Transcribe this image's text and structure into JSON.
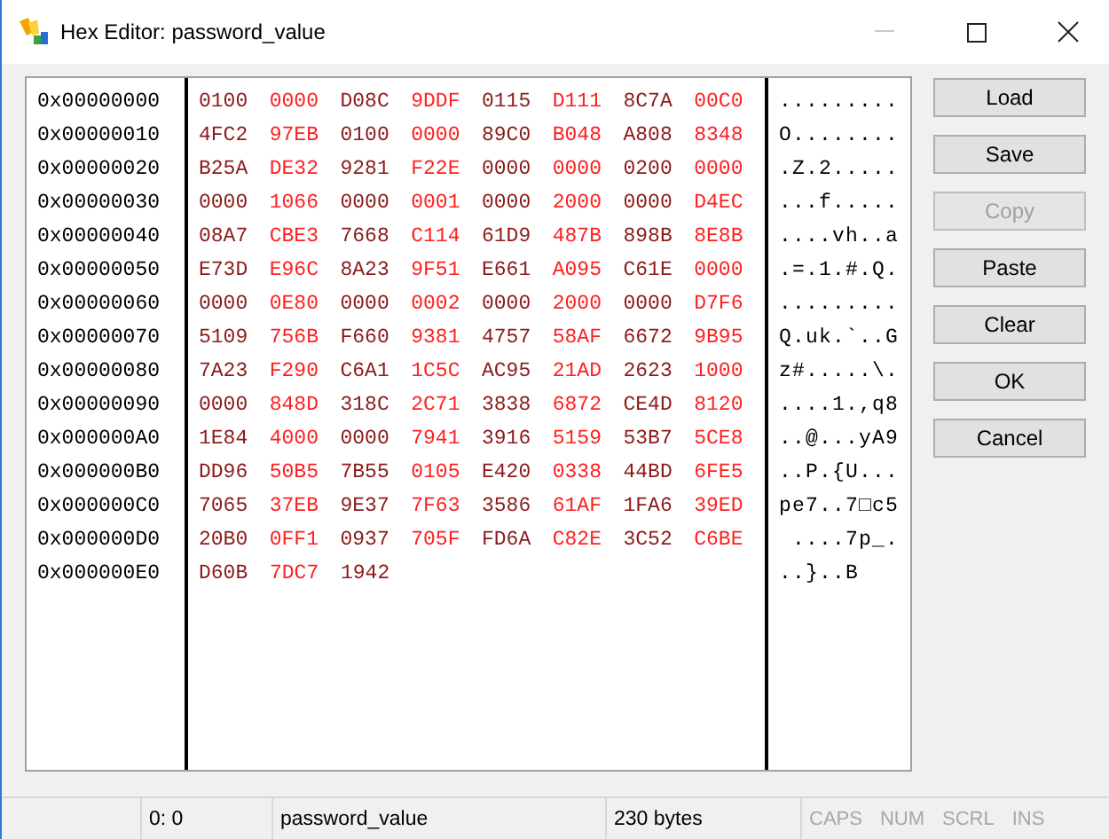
{
  "window": {
    "title": "Hex Editor: password_value",
    "controls": [
      {
        "kind": "minimize",
        "disabled": true
      },
      {
        "kind": "maximize",
        "disabled": false
      },
      {
        "kind": "close",
        "disabled": false
      }
    ]
  },
  "rows": [
    {
      "address": "0x00000000",
      "words": [
        "0100",
        "0000",
        "D08C",
        "9DDF",
        "0115",
        "D111",
        "8C7A",
        "00C0"
      ],
      "ascii": "........."
    },
    {
      "address": "0x00000010",
      "words": [
        "4FC2",
        "97EB",
        "0100",
        "0000",
        "89C0",
        "B048",
        "A808",
        "8348"
      ],
      "ascii": "O........"
    },
    {
      "address": "0x00000020",
      "words": [
        "B25A",
        "DE32",
        "9281",
        "F22E",
        "0000",
        "0000",
        "0200",
        "0000"
      ],
      "ascii": ".Z.2....."
    },
    {
      "address": "0x00000030",
      "words": [
        "0000",
        "1066",
        "0000",
        "0001",
        "0000",
        "2000",
        "0000",
        "D4EC"
      ],
      "ascii": "...f....."
    },
    {
      "address": "0x00000040",
      "words": [
        "08A7",
        "CBE3",
        "7668",
        "C114",
        "61D9",
        "487B",
        "898B",
        "8E8B"
      ],
      "ascii": "....vh..a"
    },
    {
      "address": "0x00000050",
      "words": [
        "E73D",
        "E96C",
        "8A23",
        "9F51",
        "E661",
        "A095",
        "C61E",
        "0000"
      ],
      "ascii": ".=.1.#.Q."
    },
    {
      "address": "0x00000060",
      "words": [
        "0000",
        "0E80",
        "0000",
        "0002",
        "0000",
        "2000",
        "0000",
        "D7F6"
      ],
      "ascii": "........."
    },
    {
      "address": "0x00000070",
      "words": [
        "5109",
        "756B",
        "F660",
        "9381",
        "4757",
        "58AF",
        "6672",
        "9B95"
      ],
      "ascii": "Q.uk.`..G"
    },
    {
      "address": "0x00000080",
      "words": [
        "7A23",
        "F290",
        "C6A1",
        "1C5C",
        "AC95",
        "21AD",
        "2623",
        "1000"
      ],
      "ascii": "z#.....\\."
    },
    {
      "address": "0x00000090",
      "words": [
        "0000",
        "848D",
        "318C",
        "2C71",
        "3838",
        "6872",
        "CE4D",
        "8120"
      ],
      "ascii": "....1.,q8"
    },
    {
      "address": "0x000000A0",
      "words": [
        "1E84",
        "4000",
        "0000",
        "7941",
        "3916",
        "5159",
        "53B7",
        "5CE8"
      ],
      "ascii": "..@...yA9"
    },
    {
      "address": "0x000000B0",
      "words": [
        "DD96",
        "50B5",
        "7B55",
        "0105",
        "E420",
        "0338",
        "44BD",
        "6FE5"
      ],
      "ascii": "..P.{U..."
    },
    {
      "address": "0x000000C0",
      "words": [
        "7065",
        "37EB",
        "9E37",
        "7F63",
        "3586",
        "61AF",
        "1FA6",
        "39ED"
      ],
      "ascii": "pe7..7□c5"
    },
    {
      "address": "0x000000D0",
      "words": [
        "20B0",
        "0FF1",
        "0937",
        "705F",
        "FD6A",
        "C82E",
        "3C52",
        "C6BE"
      ],
      "ascii": " ....7p_."
    },
    {
      "address": "0x000000E0",
      "words": [
        "D60B",
        "7DC7",
        "1942"
      ],
      "ascii": "..}..B"
    }
  ],
  "buttons": [
    {
      "label": "Load",
      "disabled": false
    },
    {
      "label": "Save",
      "disabled": false
    },
    {
      "label": "Copy",
      "disabled": true
    },
    {
      "label": "Paste",
      "disabled": false
    },
    {
      "label": "Clear",
      "disabled": false
    },
    {
      "label": "OK",
      "disabled": false
    },
    {
      "label": "Cancel",
      "disabled": false
    }
  ],
  "status_bar": {
    "position": "0: 0",
    "name": "password_value",
    "size": "230 bytes",
    "indicators": [
      {
        "label": "CAPS",
        "on": false
      },
      {
        "label": "NUM",
        "on": false
      },
      {
        "label": "SCRL",
        "on": false
      },
      {
        "label": "INS",
        "on": false
      }
    ]
  }
}
